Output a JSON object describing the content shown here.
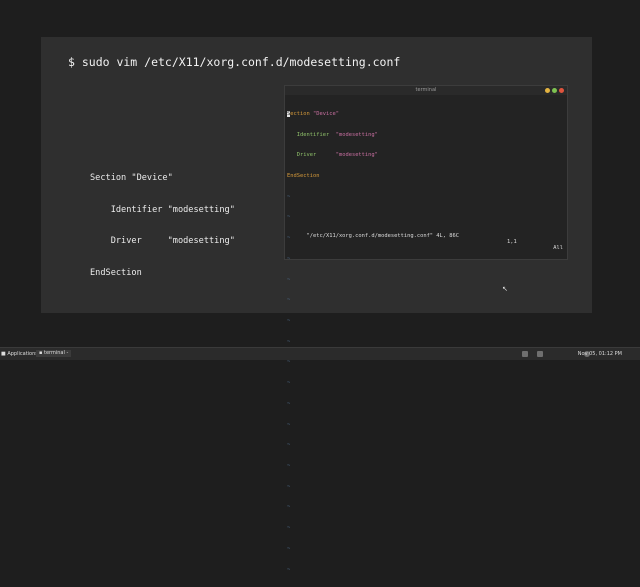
{
  "slide": {
    "command": "$ sudo vim /etc/X11/xorg.conf.d/modesetting.conf",
    "config_lines": [
      "Section \"Device\"",
      "    Identifier \"modesetting\"",
      "    Driver     \"modesetting\"",
      "EndSection"
    ]
  },
  "terminal": {
    "title": "terminal",
    "vim": {
      "section_kw": "Section",
      "section_name": "\"Device\"",
      "identifier_key": "Identifier",
      "identifier_val": "\"modesetting\"",
      "driver_key": "Driver",
      "driver_val": "\"modesetting\"",
      "end_kw": "EndSection",
      "tilde": "~"
    },
    "status": {
      "file": "\"/etc/X11/xorg.conf.d/modesetting.conf\" 4L, 86C",
      "position": "1,1",
      "scroll": "All"
    }
  },
  "taskbar": {
    "apps_label": "Applications",
    "task_label": "terminal -",
    "clock": "Nov 05, 01:12 PM"
  },
  "icons": [
    "applications-icon",
    "terminal-icon",
    "mouse-cursor-icon",
    "tray-icon"
  ]
}
